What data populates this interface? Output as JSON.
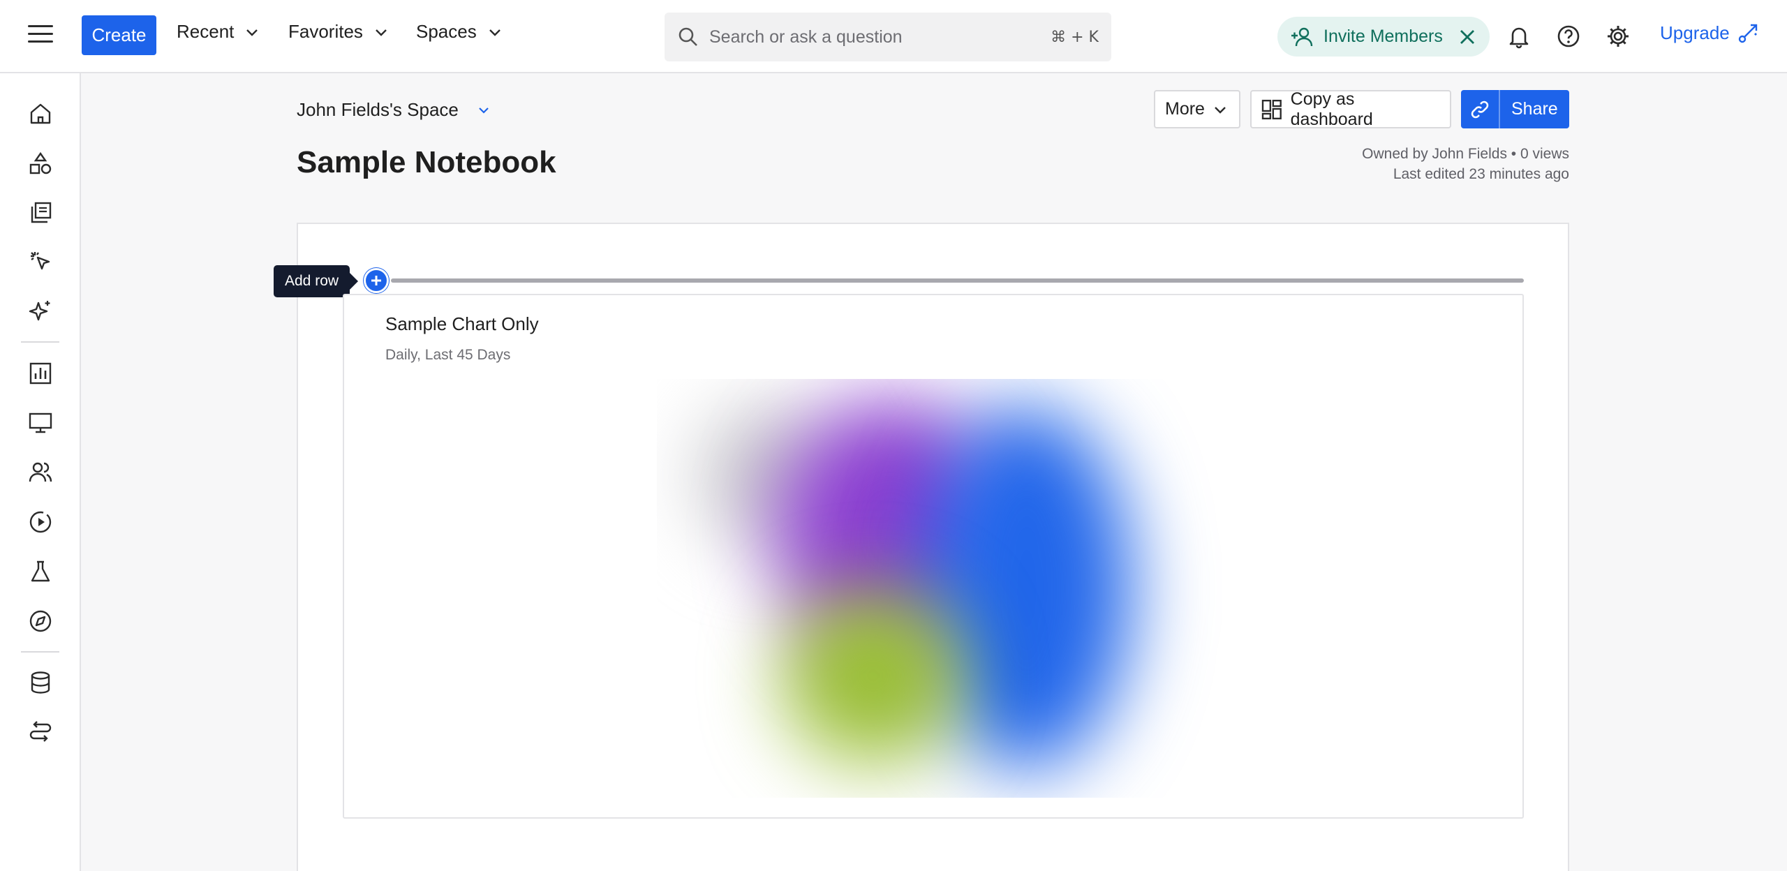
{
  "topbar": {
    "create_label": "Create",
    "nav": [
      {
        "label": "Recent"
      },
      {
        "label": "Favorites"
      },
      {
        "label": "Spaces"
      }
    ],
    "search_placeholder": "Search or ask a question",
    "search_shortcut": "⌘ + K",
    "invite_label": "Invite Members",
    "upgrade_label": "Upgrade"
  },
  "page": {
    "space_name": "John Fields's Space",
    "title": "Sample Notebook",
    "more_label": "More",
    "copy_dashboard_label": "Copy as dashboard",
    "share_label": "Share",
    "meta_line1": "Owned by John Fields • 0 views",
    "meta_line2": "Last edited 23 minutes ago"
  },
  "canvas": {
    "add_row_tooltip": "Add row",
    "chart_card": {
      "title": "Sample Chart Only",
      "subtitle": "Daily, Last 45 Days"
    }
  },
  "colors": {
    "accent": "#1d63ea",
    "invite_bg": "#e4f3f0",
    "invite_text": "#0f6f5c",
    "tooltip_bg": "#141b2e"
  },
  "icons": {
    "rail": [
      "home-icon",
      "shapes-icon",
      "library-icon",
      "click-icon",
      "sparkle-icon",
      "chart-icon",
      "monitor-icon",
      "users-icon",
      "play-circle-icon",
      "flask-icon",
      "compass-icon",
      "database-icon",
      "transform-icon"
    ]
  }
}
